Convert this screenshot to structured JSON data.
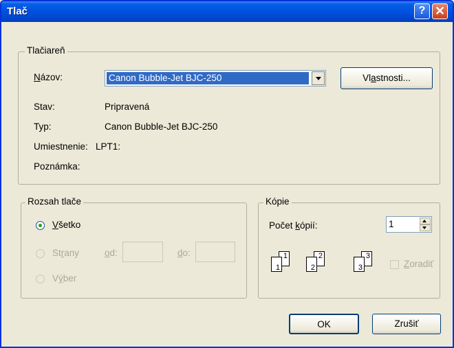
{
  "window": {
    "title": "Tlač"
  },
  "printer": {
    "legend": "Tlačiareň",
    "name_label": "Názov:",
    "name_value": "Canon Bubble-Jet BJC-250",
    "properties_button": "Vlastnosti...",
    "status_label": "Stav:",
    "status_value": "Pripravená",
    "type_label": "Typ:",
    "type_value": "Canon Bubble-Jet BJC-250",
    "location_label": "Umiestnenie:",
    "location_value": "LPT1:",
    "comment_label": "Poznámka:",
    "comment_value": ""
  },
  "range": {
    "legend": "Rozsah tlače",
    "all_label": "Všetko",
    "pages_label": "Strany",
    "from_label": "od:",
    "to_label": "do:",
    "from_value": "",
    "to_value": "",
    "selection_label": "Výber",
    "selected": "all"
  },
  "copies": {
    "legend": "Kópie",
    "count_label": "Počet kópií:",
    "count_value": "1",
    "collate_label": "Zoradiť",
    "collate_checked": false,
    "collate_pages": [
      "1",
      "2",
      "3"
    ]
  },
  "buttons": {
    "ok": "OK",
    "cancel": "Zrušiť"
  }
}
